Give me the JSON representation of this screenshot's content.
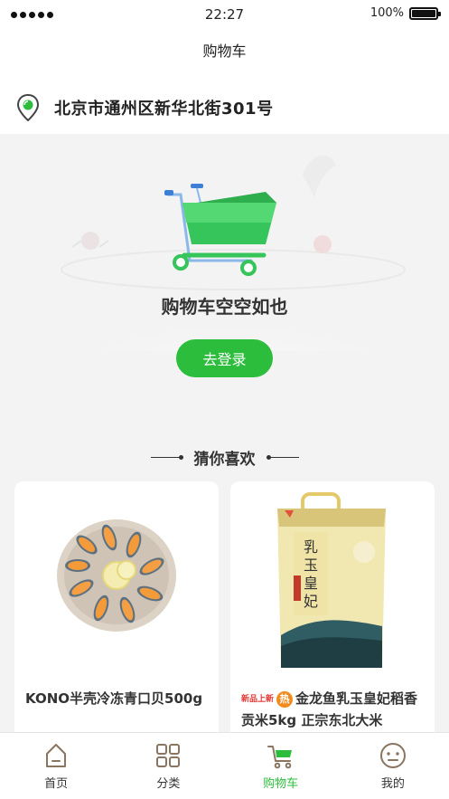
{
  "status": {
    "time": "22:27",
    "battery": "100%",
    "battery_level": 1.0
  },
  "nav": {
    "title": "购物车"
  },
  "address": {
    "text": "北京市通州区新华北街301号"
  },
  "empty": {
    "title": "购物车空空如也",
    "login_label": "去登录"
  },
  "recommend": {
    "title": "猜你喜欢",
    "products": [
      {
        "name": "KONO半壳冷冻青口贝500g"
      },
      {
        "sale_tag": "新品上新",
        "hot_tag": "热",
        "name": "金龙鱼乳玉皇妃稻香贡米5kg 正宗东北大米"
      }
    ]
  },
  "colors": {
    "accent": "#2dbd3c"
  },
  "tabs": [
    {
      "label": "首页",
      "icon": "home-icon"
    },
    {
      "label": "分类",
      "icon": "category-icon"
    },
    {
      "label": "购物车",
      "icon": "cart-icon",
      "active": true
    },
    {
      "label": "我的",
      "icon": "profile-icon"
    }
  ]
}
